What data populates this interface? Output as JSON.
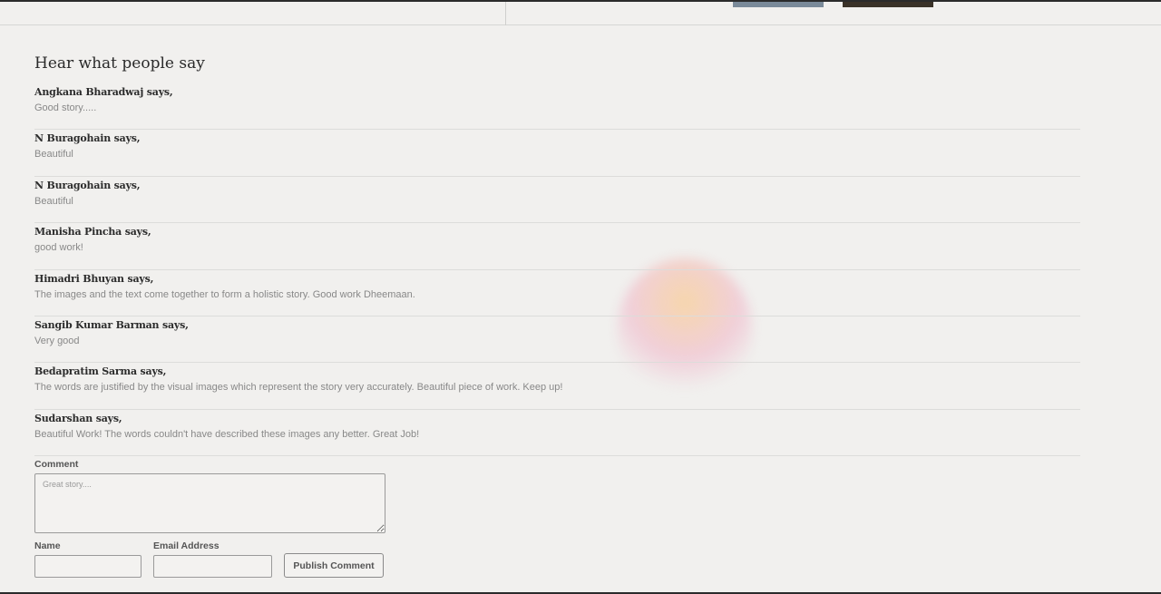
{
  "section": {
    "title": "Hear what people say"
  },
  "comments": [
    {
      "author": "Angkana Bharadwaj says,",
      "text": "Good story....."
    },
    {
      "author": "N Buragohain says,",
      "text": "Beautiful"
    },
    {
      "author": "N Buragohain says,",
      "text": "Beautiful"
    },
    {
      "author": "Manisha Pincha says,",
      "text": "good work!"
    },
    {
      "author": "Himadri Bhuyan says,",
      "text": "The images and the text come together to form a holistic story. Good work Dheemaan."
    },
    {
      "author": "Sangib Kumar Barman says,",
      "text": "Very good"
    },
    {
      "author": "Bedapratim Sarma says,",
      "text": "The words are justified by the visual images which represent the story very accurately. Beautiful piece of work. Keep up!"
    },
    {
      "author": "Sudarshan says,",
      "text": "Beautiful Work! The words couldn't have described these images any better. Great Job!"
    }
  ],
  "form": {
    "comment_label": "Comment",
    "comment_placeholder": "Great story....",
    "name_label": "Name",
    "email_label": "Email Address",
    "publish_label": "Publish Comment"
  }
}
